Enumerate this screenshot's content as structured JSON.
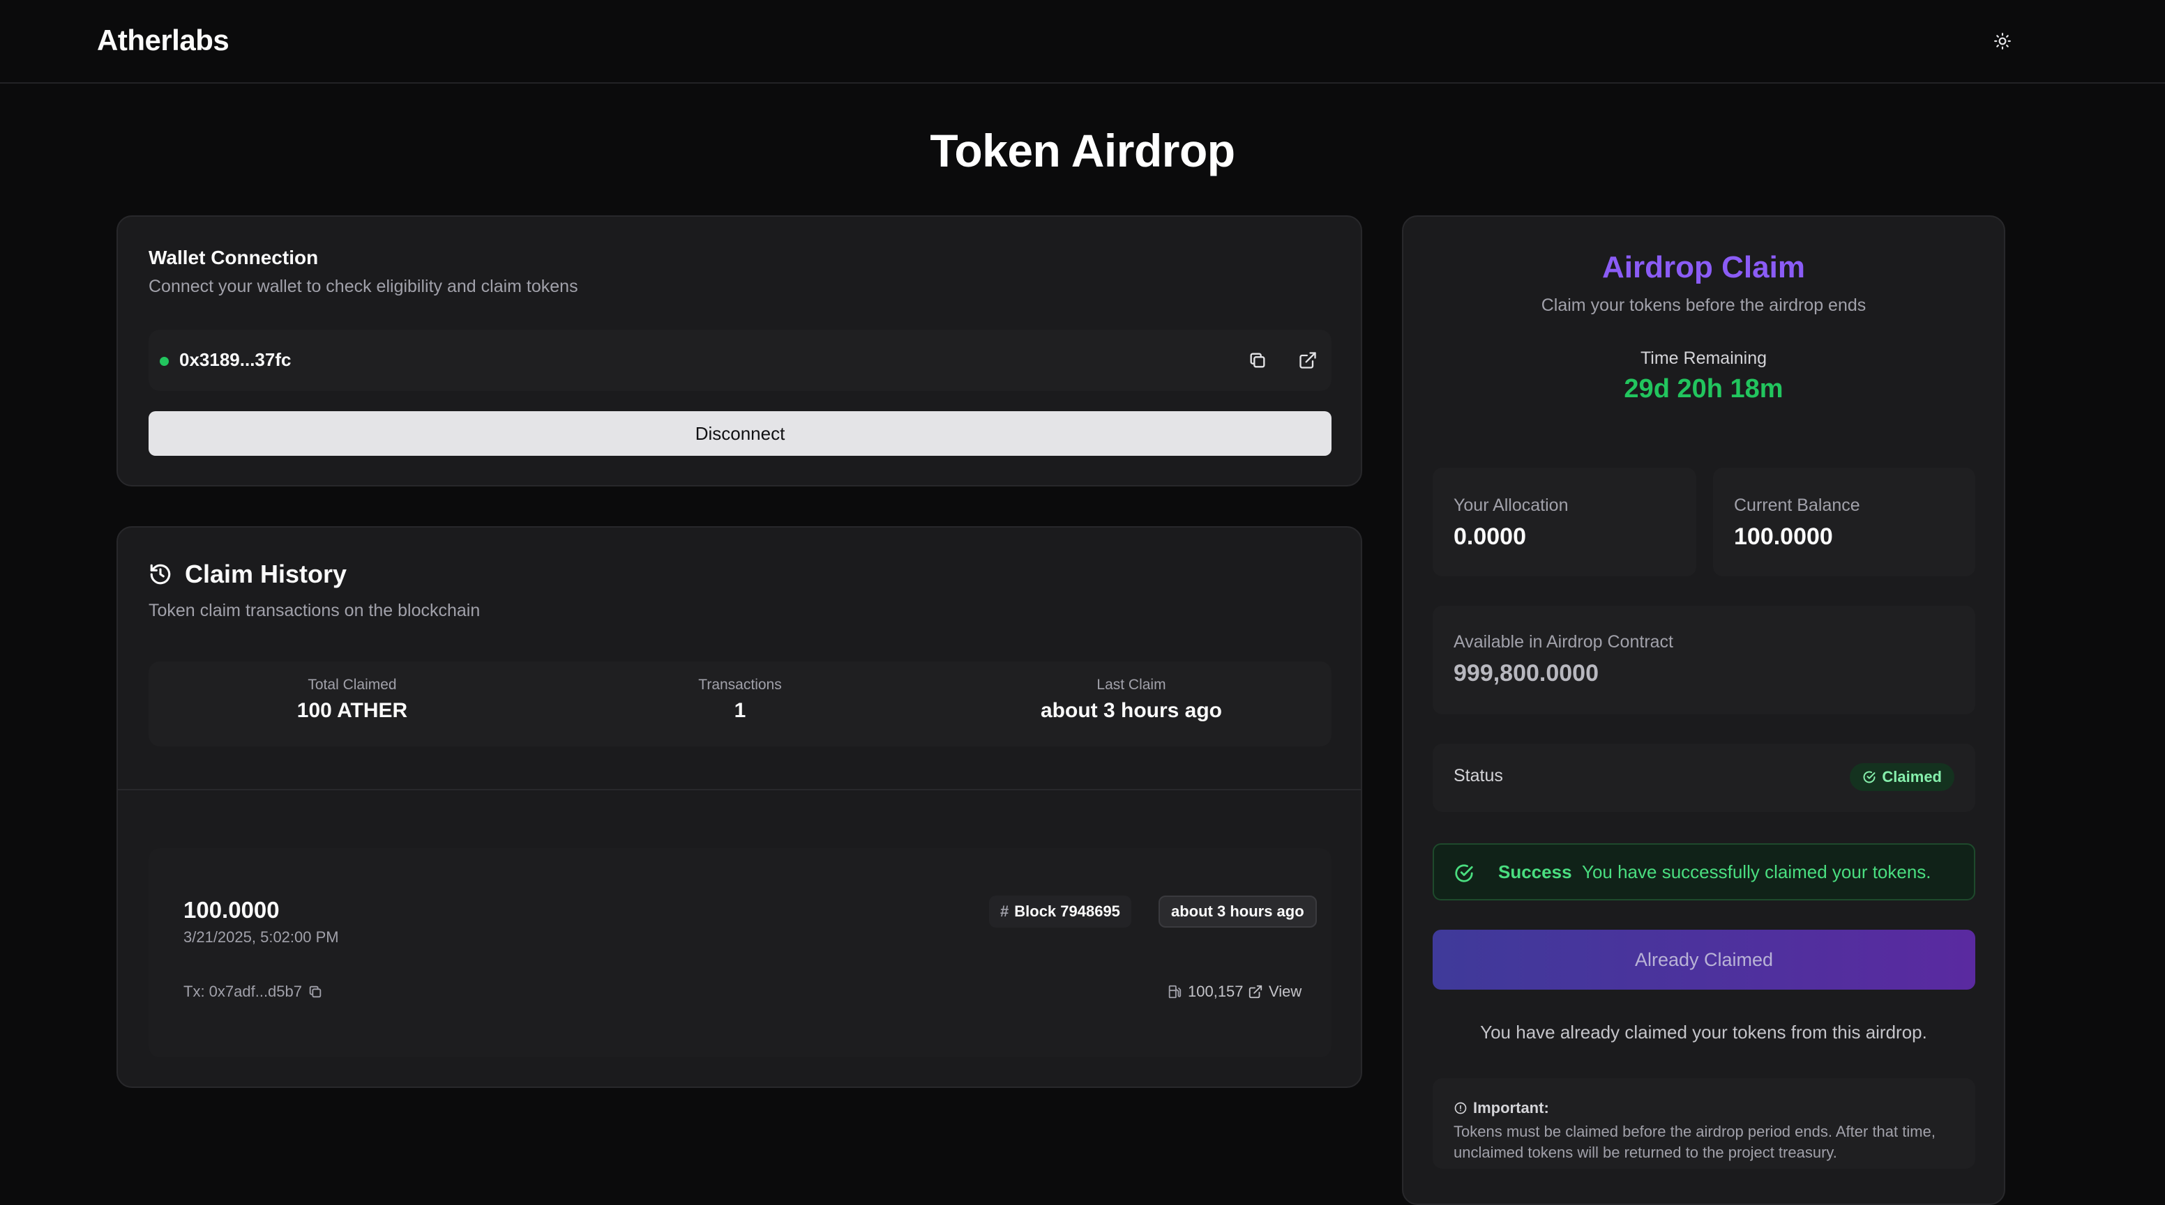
{
  "header": {
    "brand": "Atherlabs",
    "theme_toggle_icon": "sun-icon"
  },
  "page": {
    "title": "Token Airdrop"
  },
  "wallet": {
    "title": "Wallet Connection",
    "description": "Connect your wallet to check eligibility and claim tokens",
    "address": "0x3189...37fc",
    "status_color": "#22c55e",
    "disconnect_label": "Disconnect"
  },
  "history": {
    "title": "Claim History",
    "description": "Token claim transactions on the blockchain",
    "stats": [
      {
        "label": "Total Claimed",
        "value": "100 ATHER"
      },
      {
        "label": "Transactions",
        "value": "1"
      },
      {
        "label": "Last Claim",
        "value": "about 3 hours ago"
      }
    ],
    "transactions": [
      {
        "amount": "100.0000",
        "datetime": "3/21/2025, 5:02:00 PM",
        "block": "Block 7948695",
        "age": "about 3 hours ago",
        "tx": "Tx: 0x7adf...d5b7",
        "gas": "100,157",
        "view_label": "View"
      }
    ]
  },
  "claim": {
    "title": "Airdrop Claim",
    "subtitle": "Claim your tokens before the airdrop ends",
    "time_label": "Time Remaining",
    "time_value": "29d 20h 18m",
    "allocation_label": "Your Allocation",
    "allocation_value": "0.0000",
    "balance_label": "Current Balance",
    "balance_value": "100.0000",
    "contract_label": "Available in Airdrop Contract",
    "contract_value": "999,800.0000",
    "status_label": "Status",
    "status_badge": "Claimed",
    "alert_title": "Success",
    "alert_message": "You have successfully claimed your tokens.",
    "button_label": "Already Claimed",
    "note": "You have already claimed your tokens from this airdrop.",
    "important_title": "Important:",
    "important_text": "Tokens must be claimed before the airdrop period ends. After that time, unclaimed tokens will be returned to the project treasury.",
    "accent_color": "#8b5cf6",
    "success_color": "#22c55e"
  }
}
